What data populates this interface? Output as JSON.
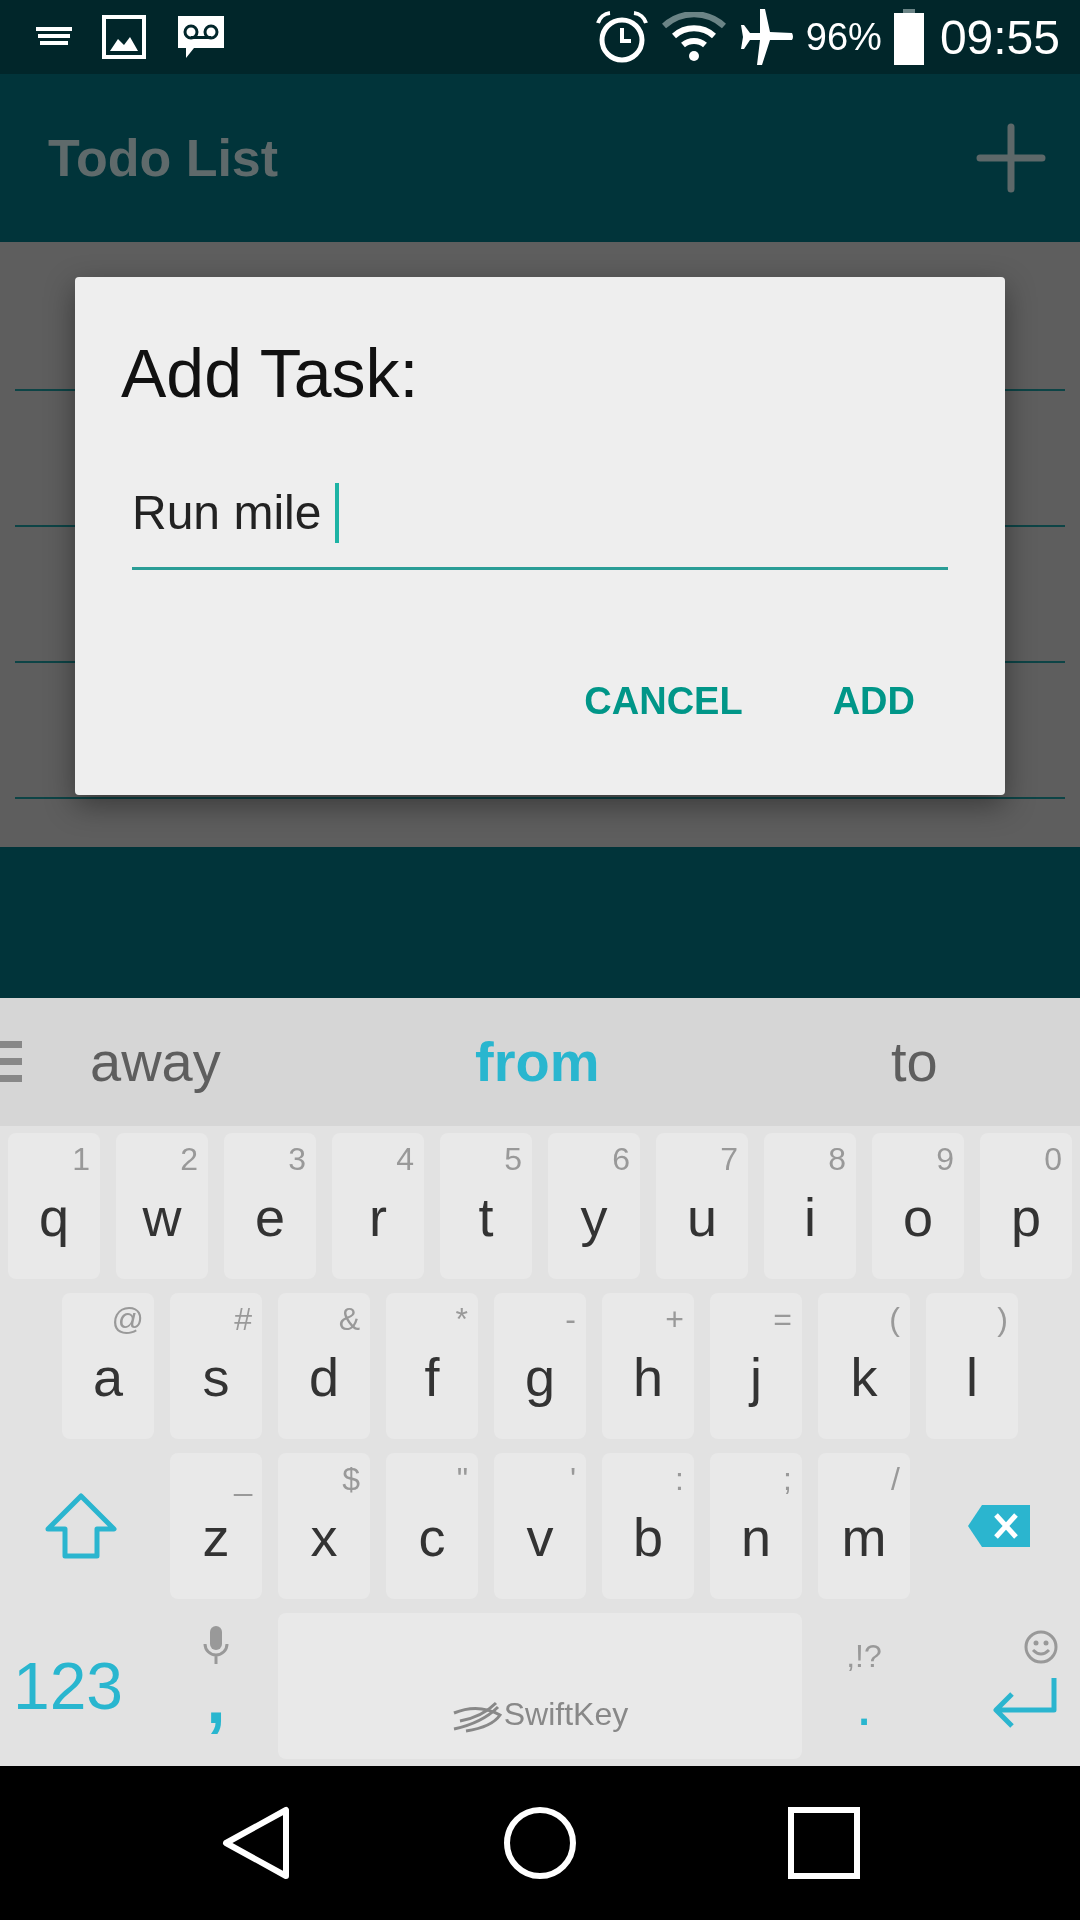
{
  "status_bar": {
    "battery": "96%",
    "time": "09:55"
  },
  "app_bar": {
    "title": "Todo List"
  },
  "dialog": {
    "title": "Add Task:",
    "field": {
      "value": "Run mile"
    },
    "buttons": [
      "CANCEL",
      "ADD"
    ]
  },
  "keyboard": {
    "suggestions": [
      {
        "text": "away",
        "selected": false
      },
      {
        "text": "from",
        "selected": true
      },
      {
        "text": "to",
        "selected": false
      }
    ],
    "rows": [
      [
        {
          "key": "q",
          "hint": "1"
        },
        {
          "key": "w",
          "hint": "2"
        },
        {
          "key": "e",
          "hint": "3"
        },
        {
          "key": "r",
          "hint": "4"
        },
        {
          "key": "t",
          "hint": "5"
        },
        {
          "key": "y",
          "hint": "6"
        },
        {
          "key": "u",
          "hint": "7"
        },
        {
          "key": "i",
          "hint": "8"
        },
        {
          "key": "o",
          "hint": "9"
        },
        {
          "key": "p",
          "hint": "0"
        }
      ],
      [
        {
          "key": "a",
          "hint": "@"
        },
        {
          "key": "s",
          "hint": "#"
        },
        {
          "key": "d",
          "hint": "&"
        },
        {
          "key": "f",
          "hint": "*"
        },
        {
          "key": "g",
          "hint": "-"
        },
        {
          "key": "h",
          "hint": "+"
        },
        {
          "key": "j",
          "hint": "="
        },
        {
          "key": "k",
          "hint": "("
        },
        {
          "key": "l",
          "hint": ")"
        }
      ],
      [
        {
          "key": "z",
          "hint": "_"
        },
        {
          "key": "x",
          "hint": "$"
        },
        {
          "key": "c",
          "hint": "\""
        },
        {
          "key": "v",
          "hint": "'"
        },
        {
          "key": "b",
          "hint": ":"
        },
        {
          "key": "n",
          "hint": ";"
        },
        {
          "key": "m",
          "hint": "/"
        }
      ]
    ],
    "bottom_row": {
      "mode_key": "123",
      "comma": ",",
      "space_label": "SwiftKey",
      "period": ".",
      "punct_hint": ",!?"
    }
  }
}
